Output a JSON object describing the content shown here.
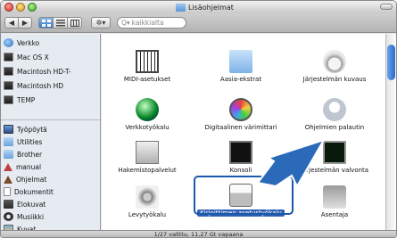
{
  "window": {
    "title": "Lisäohjelmat"
  },
  "toolbar": {
    "back_label": "◀",
    "forward_label": "▶",
    "action_label": "✲▾",
    "search_placeholder": "kaikkialta",
    "search_icon_label": "Q▾"
  },
  "sidebar": {
    "devices": [
      {
        "label": "Verkko",
        "icon": "globe"
      },
      {
        "label": "Mac OS X",
        "icon": "drive"
      },
      {
        "label": "Macintosh HD-T-",
        "icon": "drive"
      },
      {
        "label": "Macintosh HD",
        "icon": "drive"
      },
      {
        "label": "TEMP",
        "icon": "drive"
      }
    ],
    "places": [
      {
        "label": "Työpöytä",
        "icon": "monitor"
      },
      {
        "label": "Utilities",
        "icon": "folder"
      },
      {
        "label": "Brother",
        "icon": "folder"
      },
      {
        "label": "manual",
        "icon": "home"
      },
      {
        "label": "Ohjelmat",
        "icon": "apps"
      },
      {
        "label": "Dokumentit",
        "icon": "doc"
      },
      {
        "label": "Elokuvat",
        "icon": "movie"
      },
      {
        "label": "Musiikki",
        "icon": "music"
      },
      {
        "label": "Kuvat",
        "icon": "pics"
      }
    ]
  },
  "apps": [
    {
      "label": "MIDI-asetukset",
      "icon": "midi"
    },
    {
      "label": "Aasia-ekstrat",
      "icon": "folder"
    },
    {
      "label": "Järjestelmän kuvaus",
      "icon": "system-profiler"
    },
    {
      "label": "Verkkotyökalu",
      "icon": "network-utility"
    },
    {
      "label": "Digitaalinen värimittari",
      "icon": "color-meter"
    },
    {
      "label": "Ohjelmien palautin",
      "icon": "migration-assistant"
    },
    {
      "label": "Hakemistopalvelut",
      "icon": "directory-utility"
    },
    {
      "label": "Konsoli",
      "icon": "console"
    },
    {
      "label": "Järjestelmän valvonta",
      "icon": "activity-monitor"
    },
    {
      "label": "Levytyökalu",
      "icon": "disk-utility"
    },
    {
      "label": "Kirjoittimen asetustyökalu",
      "icon": "printer-setup",
      "selected": true
    },
    {
      "label": "Asentaja",
      "icon": "installer"
    }
  ],
  "status": {
    "text": "1/27 valittu, 11,27 Gt vapaana"
  },
  "colors": {
    "accent": "#2f5fb5",
    "arrow": "#2a6ab8"
  }
}
